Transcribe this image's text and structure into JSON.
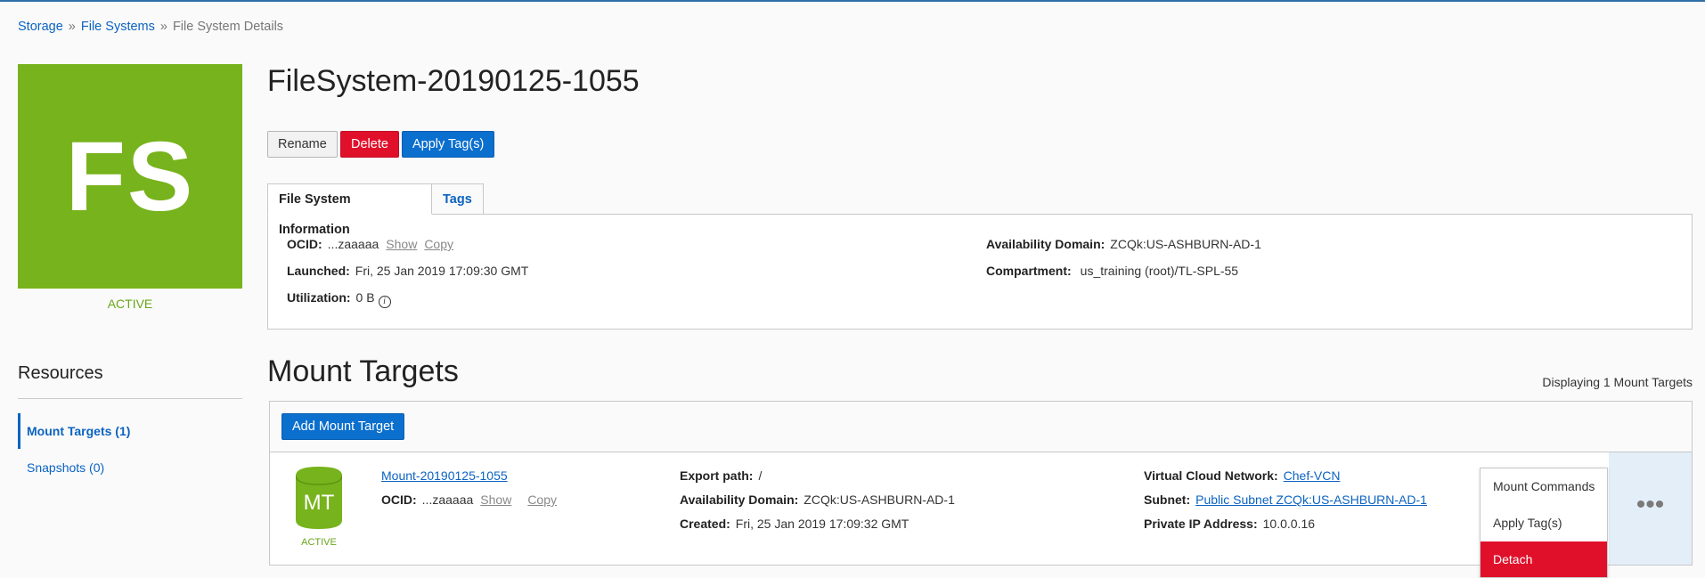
{
  "breadcrumb": {
    "items": [
      "Storage",
      "File Systems",
      "File System Details"
    ],
    "separator": "»"
  },
  "file_system": {
    "tile_text": "FS",
    "tile_color": "#77b31c",
    "status": "ACTIVE",
    "title": "FileSystem-20190125-1055"
  },
  "buttons": {
    "rename": "Rename",
    "delete": "Delete",
    "apply_tags": "Apply Tag(s)"
  },
  "tabs": {
    "info": "File System Information",
    "tags": "Tags"
  },
  "info": {
    "ocid_label": "OCID:",
    "ocid_value": "...zaaaaa",
    "show": "Show",
    "copy": "Copy",
    "launched_label": "Launched:",
    "launched_value": "Fri, 25 Jan 2019 17:09:30 GMT",
    "utilization_label": "Utilization:",
    "utilization_value": "0 B",
    "utilization_info_icon": "i",
    "ad_label": "Availability Domain:",
    "ad_value": "ZCQk:US-ASHBURN-AD-1",
    "compartment_label": "Compartment:",
    "compartment_value": "us_training (root)/TL-SPL-55"
  },
  "resources": {
    "title": "Resources",
    "items": [
      "Mount Targets (1)",
      "Snapshots (0)"
    ]
  },
  "mount_targets": {
    "title": "Mount Targets",
    "count_text": "Displaying 1 Mount Targets",
    "add_button": "Add Mount Target",
    "row": {
      "badge_text": "MT",
      "badge_color": "#77b31c",
      "status": "ACTIVE",
      "name": "Mount-20190125-1055",
      "ocid_label": "OCID:",
      "ocid_value": "...zaaaaa",
      "show": "Show",
      "copy": "Copy",
      "export_label": "Export path:",
      "export_value": "/",
      "ad_label": "Availability Domain:",
      "ad_value": "ZCQk:US-ASHBURN-AD-1",
      "created_label": "Created:",
      "created_value": "Fri, 25 Jan 2019 17:09:32 GMT",
      "vcn_label": "Virtual Cloud Network:",
      "vcn_value": "Chef-VCN",
      "subnet_label": "Subnet:",
      "subnet_value": "Public Subnet ZCQk:US-ASHBURN-AD-1",
      "ip_label": "Private IP Address:",
      "ip_value": "10.0.0.16"
    },
    "actions_icon": "more-actions-icon",
    "menu": [
      "Mount Commands",
      "Apply Tag(s)",
      "Detach"
    ]
  }
}
